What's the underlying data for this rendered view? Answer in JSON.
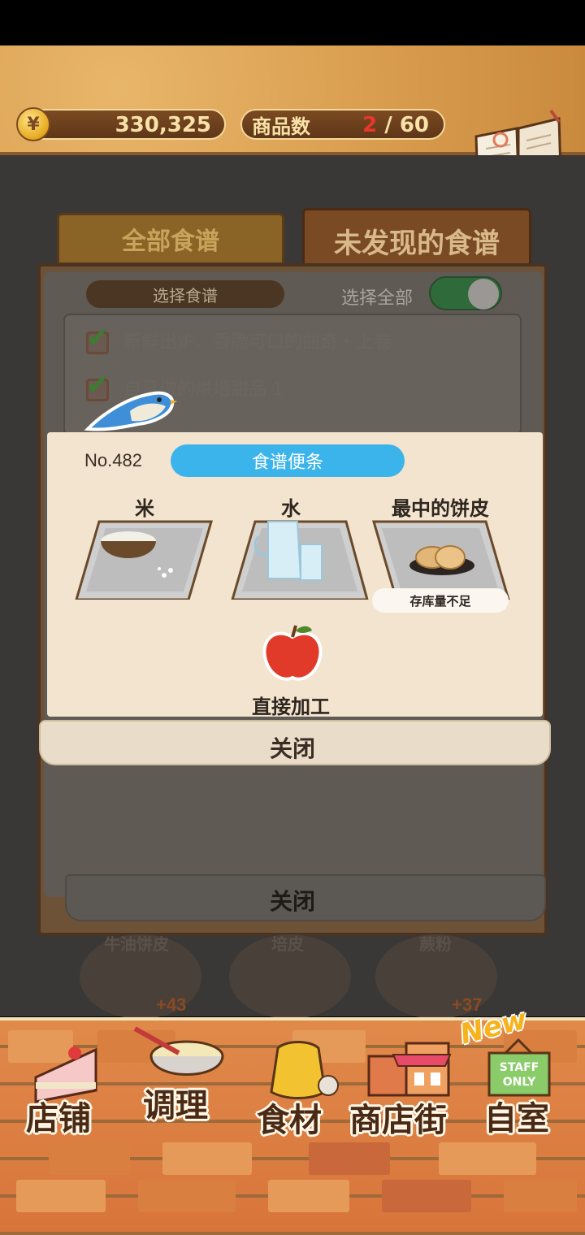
{
  "header": {
    "coin_symbol": "¥",
    "coins": "330,325",
    "goods_label": "商品数",
    "goods_current": "2",
    "goods_sep": " / ",
    "goods_max": "60",
    "recipe_book_label": "食谱"
  },
  "tabs": [
    {
      "label": "全部食谱"
    },
    {
      "label": "未发现的食谱"
    }
  ],
  "panel": {
    "select_recipe_label": "选择食谱",
    "select_all_label": "选择全部",
    "items": [
      {
        "label": "新鲜出炉、香脆可口的曲奇・上卷"
      },
      {
        "label": "自己做的烘培甜品 1"
      }
    ],
    "close_label": "关闭"
  },
  "note": {
    "number": "No.482",
    "title": "食谱便条",
    "ingredients": [
      {
        "label": "米",
        "icon": "rice-bowl-icon"
      },
      {
        "label": "水",
        "icon": "water-pitcher-icon"
      },
      {
        "label": "最中的饼皮",
        "icon": "monaka-wafer-icon",
        "status": "存库量不足"
      }
    ],
    "process_label": "直接加工",
    "close_label": "关闭"
  },
  "under_items": [
    {
      "label": "牛油饼皮",
      "plus": "+43"
    },
    {
      "label": "培皮",
      "plus": ""
    },
    {
      "label": "蕨粉",
      "plus": "+37"
    }
  ],
  "nav": {
    "new_badge": "New",
    "items": [
      {
        "label": "店铺",
        "icon": "cake-icon"
      },
      {
        "label": "调理",
        "icon": "mixing-bowl-icon"
      },
      {
        "label": "食材",
        "icon": "flour-sack-icon"
      },
      {
        "label": "商店街",
        "icon": "shop-street-icon"
      },
      {
        "label": "自室",
        "icon": "staff-only-sign-icon"
      }
    ]
  },
  "colors": {
    "accent_blue": "#3bb4ec",
    "toggle_green": "#2f6a3a",
    "goods_red": "#e8382b"
  }
}
